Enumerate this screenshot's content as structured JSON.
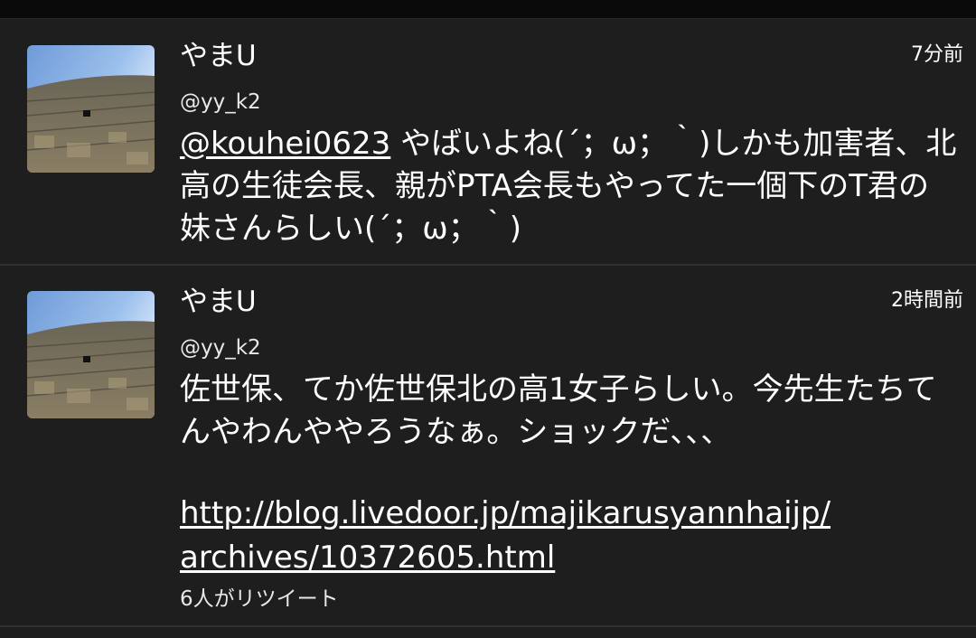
{
  "timeline": {
    "tweets": [
      {
        "name": "やまU",
        "handle": "@yy_k2",
        "time": "7分前",
        "mention": "@kouhei0623",
        "text": " やばいよね(´；ω；｀)しかも加害者、北高の生徒会長、親がPTA会長もやってた一個下のT君の妹さんらしい(´；ω；｀)",
        "avatar_icon": "profile-photo-icon"
      },
      {
        "name": "やまU",
        "handle": "@yy_k2",
        "time": "2時間前",
        "text": "佐世保、てか佐世保北の高1女子らしい。今先生たちてんやわんややろうなぁ。ショックだ、、、",
        "link_line1": "http://blog.livedoor.jp/majikarusyannhaijp/",
        "link_line2": "archives/10372605.html",
        "retweet_info": "6人がリツイート",
        "avatar_icon": "profile-photo-icon"
      }
    ]
  }
}
